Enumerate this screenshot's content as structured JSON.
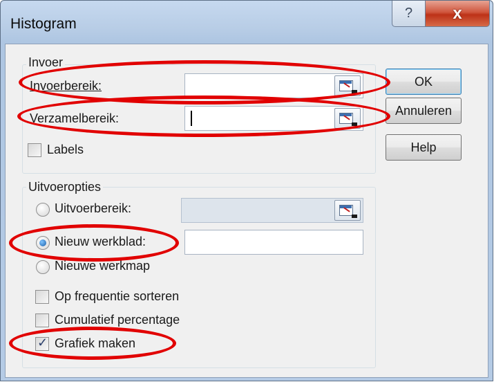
{
  "dialog": {
    "title": "Histogram",
    "help_icon": "?",
    "close_icon": "x"
  },
  "input_group": {
    "legend": "Invoer",
    "input_range_label": "Invoerbereik:",
    "input_range_value": "",
    "bin_range_label": "Verzamelbereik:",
    "bin_range_value": "",
    "labels_label": "Labels",
    "labels_checked": false
  },
  "output_group": {
    "legend": "Uitvoeropties",
    "output_range_label": "Uitvoerbereik:",
    "output_range_value": "",
    "new_sheet_label": "Nieuw werkblad:",
    "new_sheet_value": "",
    "new_workbook_label": "Nieuwe werkmap",
    "selected_option": "Nieuw werkblad",
    "pareto_label": "Op frequentie sorteren",
    "pareto_checked": false,
    "cumulative_label": "Cumulatief percentage",
    "cumulative_checked": false,
    "chart_label": "Grafiek maken",
    "chart_checked": true
  },
  "buttons": {
    "ok": "OK",
    "cancel": "Annuleren",
    "help": "Help"
  },
  "colors": {
    "annotation": "#e10000",
    "title_bar": "#b8cde6"
  }
}
